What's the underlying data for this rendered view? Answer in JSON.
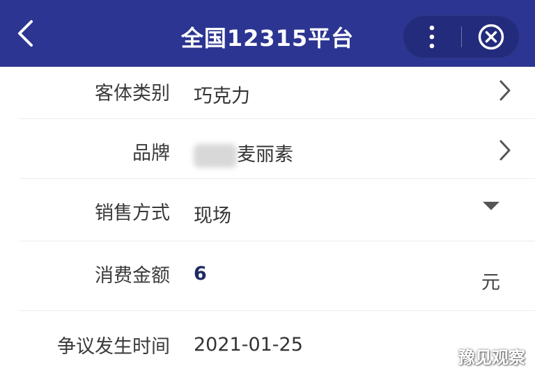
{
  "header": {
    "title": "全国12315平台",
    "back_icon": "chevron-left-icon",
    "more_icon": "more-vertical-icon",
    "close_icon": "close-circle-icon",
    "background_color": "#2c3591"
  },
  "form": {
    "rows": [
      {
        "label": "客体类别",
        "value": "巧克力",
        "control": "chevron-right-icon"
      },
      {
        "label": "品牌",
        "value": "麦丽素",
        "control": "chevron-right-icon"
      },
      {
        "label": "销售方式",
        "value": "现场",
        "control": "dropdown-triangle-icon"
      },
      {
        "label": "消费金额",
        "value": "6",
        "unit": "元"
      },
      {
        "label": "争议发生时间",
        "value": "2021-01-25"
      }
    ]
  },
  "watermark": {
    "text": "豫见观察"
  }
}
